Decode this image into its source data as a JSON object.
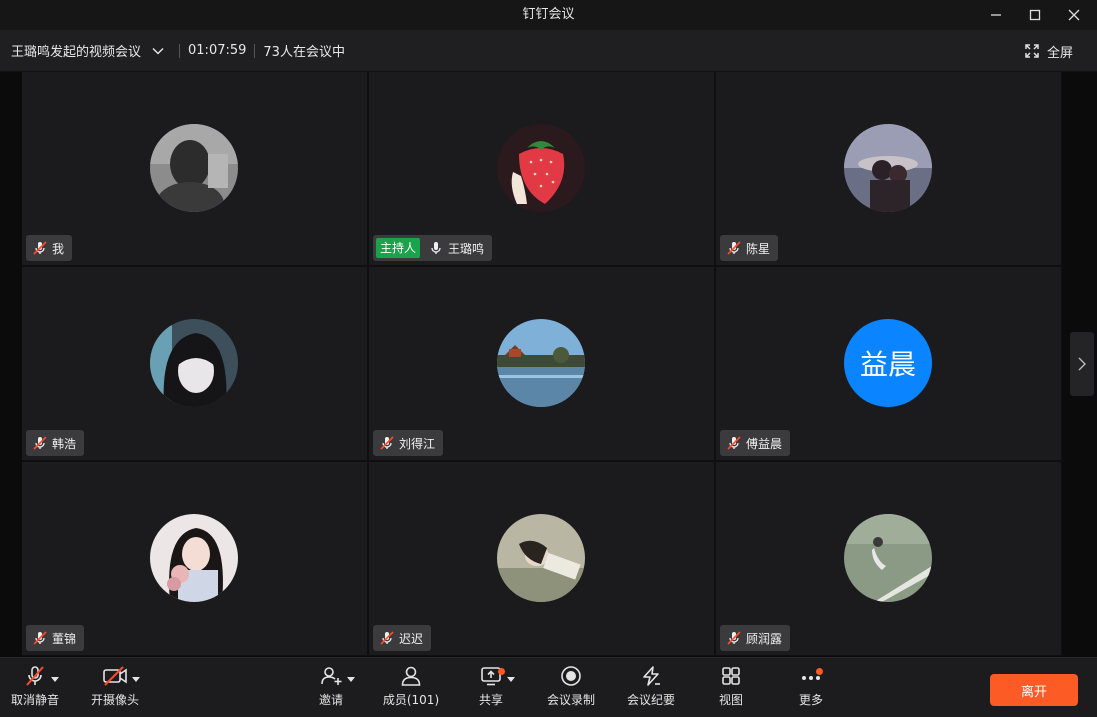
{
  "window": {
    "title": "钉钉会议"
  },
  "info_bar": {
    "meeting_title": "王璐鸣发起的视频会议",
    "duration": "01:07:59",
    "participants_status": "73人在会议中",
    "fullscreen_label": "全屏"
  },
  "participants": [
    {
      "name": "我",
      "mic": "muted",
      "avatar": "grayscale-photo"
    },
    {
      "name": "王璐鸣",
      "mic": "on",
      "host_tag": "主持人",
      "avatar": "strawberry-art"
    },
    {
      "name": "陈星",
      "mic": "muted",
      "avatar": "sunset-couple-photo"
    },
    {
      "name": "韩浩",
      "mic": "muted",
      "avatar": "anime-girl-art"
    },
    {
      "name": "刘得江",
      "mic": "muted",
      "avatar": "lake-pavilion-photo"
    },
    {
      "name": "傅益晨",
      "mic": "muted",
      "avatar_text": "益晨",
      "avatar_color": "#0a84ff"
    },
    {
      "name": "董锦",
      "mic": "muted",
      "avatar": "girl-flowers-photo"
    },
    {
      "name": "迟迟",
      "mic": "muted",
      "avatar": "girl-lying-photo"
    },
    {
      "name": "顾润露",
      "mic": "muted",
      "avatar": "grass-figure-photo"
    }
  ],
  "toolbar": {
    "unmute": "取消静音",
    "camera": "开摄像头",
    "invite": "邀请",
    "members": "成员(101)",
    "share": "共享",
    "record": "会议录制",
    "minutes": "会议纪要",
    "view": "视图",
    "more": "更多",
    "leave": "离开"
  },
  "colors": {
    "host_tag": "#1aa34a",
    "leave_button": "#fd5b26",
    "badge_dot": "#ff5a1f",
    "mute_slash": "#ff4b2b"
  }
}
